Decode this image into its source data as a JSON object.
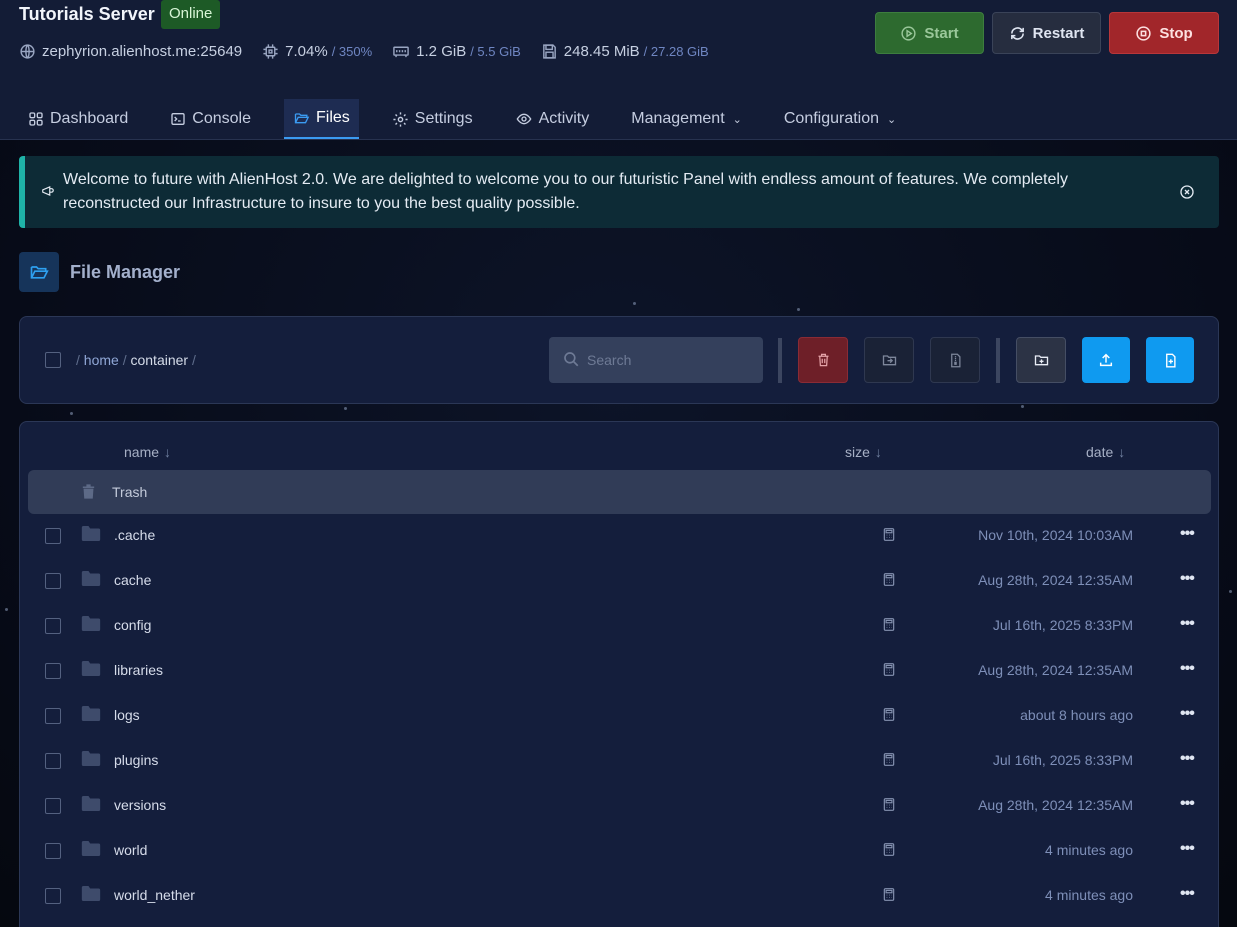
{
  "server": {
    "title": "Tutorials Server",
    "status": "Online",
    "address": "zephyrion.alienhost.me:25649",
    "cpu": "7.04%",
    "cpu_limit": "/ 350%",
    "memory": "1.2 GiB",
    "memory_limit": "/ 5.5 GiB",
    "disk": "248.45 MiB",
    "disk_limit": "/ 27.28 GiB"
  },
  "power": {
    "start": "Start",
    "restart": "Restart",
    "stop": "Stop"
  },
  "tabs": [
    {
      "label": "Dashboard",
      "icon": "grid-icon"
    },
    {
      "label": "Console",
      "icon": "terminal-icon"
    },
    {
      "label": "Files",
      "icon": "folder-icon",
      "active": true
    },
    {
      "label": "Settings",
      "icon": "gear-icon"
    },
    {
      "label": "Activity",
      "icon": "eye-icon"
    },
    {
      "label": "Management",
      "dropdown": true
    },
    {
      "label": "Configuration",
      "dropdown": true
    }
  ],
  "alert": {
    "text": "Welcome to future with AlienHost 2.0. We are delighted to welcome you to our futuristic Panel with endless amount of features. We completely reconstructed our Infrastructure to insure to you the best quality possible."
  },
  "file_manager": {
    "title": "File Manager",
    "breadcrumb": {
      "home": "home",
      "current": "container"
    },
    "search_placeholder": "Search",
    "columns": {
      "name": "name",
      "size": "size",
      "date": "date",
      "sort_arrow": "↓"
    },
    "trash_label": "Trash",
    "files": [
      {
        "name": ".cache",
        "date": "Nov 10th, 2024 10:03AM"
      },
      {
        "name": "cache",
        "date": "Aug 28th, 2024 12:35AM"
      },
      {
        "name": "config",
        "date": "Jul 16th, 2025 8:33PM"
      },
      {
        "name": "libraries",
        "date": "Aug 28th, 2024 12:35AM"
      },
      {
        "name": "logs",
        "date": "about 8 hours ago"
      },
      {
        "name": "plugins",
        "date": "Jul 16th, 2025 8:33PM"
      },
      {
        "name": "versions",
        "date": "Aug 28th, 2024 12:35AM"
      },
      {
        "name": "world",
        "date": "4 minutes ago"
      },
      {
        "name": "world_nether",
        "date": "4 minutes ago"
      }
    ]
  },
  "colors": {
    "accent": "#0f9af0",
    "start": "#2d6a2f",
    "stop": "#a1262a",
    "online": "#1d5a26",
    "alert_border": "#1fb3a8"
  }
}
